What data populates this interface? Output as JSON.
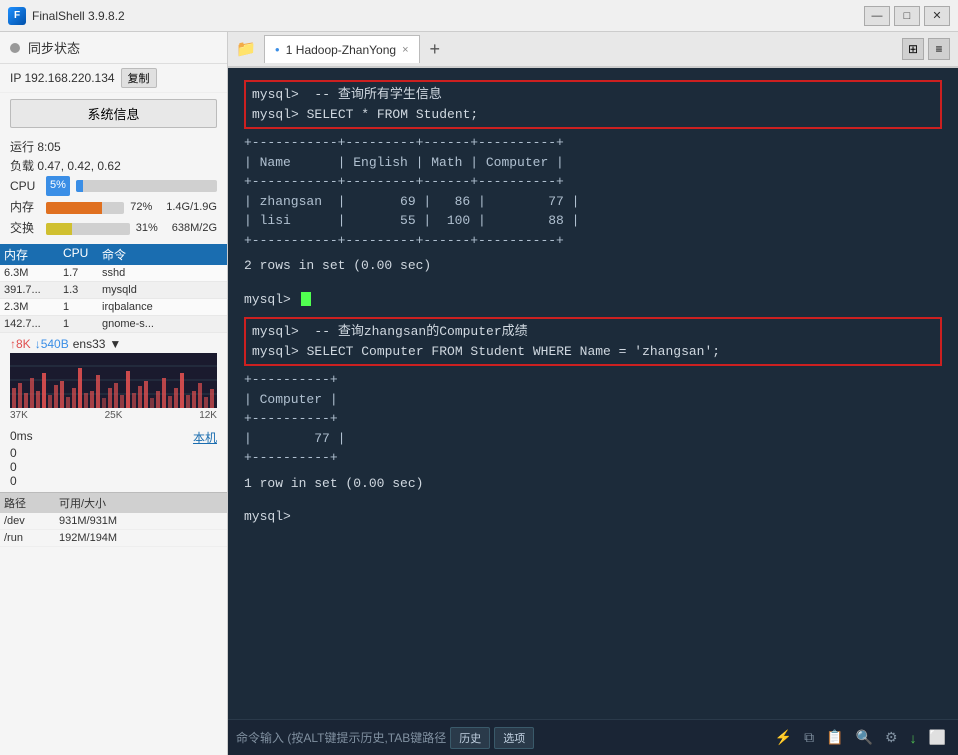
{
  "titlebar": {
    "title": "FinalShell 3.9.8.2",
    "minimize": "—",
    "maximize": "□",
    "close": "✕"
  },
  "sidebar": {
    "sync_label": "同步状态",
    "ip": "IP 192.168.220.134",
    "copy_btn": "复制",
    "sys_info_btn": "系统信息",
    "uptime_label": "运行 8:05",
    "load_label": "负载 0.47, 0.42, 0.62",
    "cpu_label": "CPU",
    "cpu_value": "5%",
    "mem_label": "内存",
    "mem_pct": "72%",
    "mem_val": "1.4G/1.9G",
    "swap_label": "交换",
    "swap_pct": "31%",
    "swap_val": "638M/2G",
    "proc_header": [
      "内存",
      "CPU",
      "命令"
    ],
    "processes": [
      {
        "mem": "6.3M",
        "cpu": "1.7",
        "cmd": "sshd"
      },
      {
        "mem": "391.7...",
        "cpu": "1.3",
        "cmd": "mysqld"
      },
      {
        "mem": "2.3M",
        "cpu": "1",
        "cmd": "irqbalance"
      },
      {
        "mem": "142.7...",
        "cpu": "1",
        "cmd": "gnome-s..."
      }
    ],
    "net_up": "↑8K",
    "net_down": "↓540B",
    "net_iface": "ens33",
    "net_labels": [
      "37K",
      "25K",
      "12K"
    ],
    "latency_ms": "0ms",
    "latency_link": "本机",
    "latency_values": [
      "0",
      "0",
      "0"
    ],
    "path_header": [
      "路径",
      "可用/大小"
    ],
    "paths": [
      {
        "path": "/dev",
        "size": "931M/931M"
      },
      {
        "path": "/run",
        "size": "192M/194M"
      }
    ]
  },
  "tabs": {
    "folder_icon": "📁",
    "active_tab": "1 Hadoop-ZhanYong",
    "close_icon": "×",
    "add_icon": "+",
    "view_grid": "⊞",
    "view_list": "≡"
  },
  "terminal": {
    "lines": [
      {
        "type": "cmd-block",
        "lines": [
          "mysql>  -- 查询所有学生信息",
          "mysql> SELECT * FROM Student;"
        ]
      },
      {
        "type": "table",
        "lines": [
          "+-----------+---------+------+----------+",
          "| Name      | English | Math | Computer |",
          "+-----------+---------+------+----------+",
          "| zhangsan  |      69 |   86 |       77 |",
          "| lisi      |      55 |  100 |       88 |",
          "+-----------+---------+------+----------+"
        ]
      },
      {
        "type": "plain",
        "text": "2 rows in set (0.00 sec)"
      },
      {
        "type": "plain",
        "text": ""
      },
      {
        "type": "prompt-cursor",
        "text": "mysql> "
      },
      {
        "type": "cmd-block",
        "lines": [
          "mysql>  -- 查询zhangsan的Computer成绩",
          "mysql> SELECT Computer FROM Student WHERE Name = 'zhangsan';"
        ]
      },
      {
        "type": "table",
        "lines": [
          "+----------+",
          "| Computer |",
          "+----------+",
          "|       77 |",
          "+----------+"
        ]
      },
      {
        "type": "plain",
        "text": "1 row in set (0.00 sec)"
      },
      {
        "type": "plain",
        "text": ""
      },
      {
        "type": "plain",
        "text": "mysql>"
      }
    ]
  },
  "cmdbar": {
    "label": "命令输入 (按ALT键提示历史,TAB键路径",
    "history_btn": "历史",
    "options_btn": "选项",
    "lightning_icon": "⚡",
    "copy_icon": "⧉",
    "paste_icon": "📋",
    "search_icon": "🔍",
    "settings_icon": "⚙",
    "download_icon": "↓",
    "window_icon": "⬜"
  }
}
